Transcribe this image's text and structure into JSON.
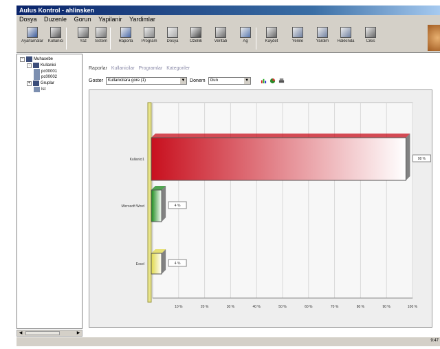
{
  "window": {
    "title": "Aulus Kontrol - ahlinsken"
  },
  "menu": [
    "Dosya",
    "Duzenle",
    "Gorun",
    "Yapilanir",
    "Yardimlar"
  ],
  "toolbar": [
    {
      "label": "Ayarlamalar",
      "icon": "settings-icon"
    },
    {
      "label": "Kullanici",
      "icon": "user-icon"
    },
    {
      "label": "Yaz",
      "icon": "print-icon"
    },
    {
      "label": "Sistem",
      "icon": "system-icon"
    },
    {
      "label": "Raporla",
      "icon": "report-icon"
    },
    {
      "label": "Program",
      "icon": "program-icon"
    },
    {
      "label": "Dosya",
      "icon": "file-icon"
    },
    {
      "label": "Ozellik",
      "icon": "properties-icon"
    },
    {
      "label": "Veritab",
      "icon": "database-icon"
    },
    {
      "label": "Ag",
      "icon": "network-icon"
    },
    {
      "label": "Kaydet",
      "icon": "save-icon"
    },
    {
      "label": "Yenile",
      "icon": "refresh-icon"
    },
    {
      "label": "Yardim",
      "icon": "help-icon"
    },
    {
      "label": "Hakkinda",
      "icon": "about-icon"
    },
    {
      "label": "Cikis",
      "icon": "exit-icon"
    }
  ],
  "tree": [
    {
      "label": "Muhasebe",
      "level": 0,
      "expanded": "-"
    },
    {
      "label": "Kullanici",
      "level": 1,
      "expanded": "-"
    },
    {
      "label": "pc00001",
      "level": 2
    },
    {
      "label": "pc00002",
      "level": 2
    },
    {
      "label": "Gruplar",
      "level": 1,
      "expanded": "+"
    },
    {
      "label": "Ist",
      "level": 2
    }
  ],
  "main": {
    "tabs": [
      "Raporlar",
      "Kullanicilar",
      "Programlar",
      "Kategoriler"
    ],
    "filter_label": "Goster",
    "filter_value": "Kullanicilara gore (1)",
    "period_label": "Donem",
    "period_value": "Gun"
  },
  "chart_data": {
    "type": "bar",
    "orientation": "horizontal",
    "categories": [
      "Kullanici1",
      "Microsoft Word",
      "Excel"
    ],
    "values": [
      98,
      4,
      4
    ],
    "value_labels": [
      "98 %",
      "4 %",
      "4 %"
    ],
    "bar_colors": [
      "#c8101e",
      "#1a8a1a",
      "#e0d848"
    ],
    "x_ticks": [
      "10 %",
      "20 %",
      "30 %",
      "40 %",
      "50 %",
      "60 %",
      "70 %",
      "80 %",
      "90 %",
      "100 %"
    ],
    "xlim": [
      0,
      100
    ],
    "grid": true
  },
  "status": {
    "time": "9:47"
  }
}
